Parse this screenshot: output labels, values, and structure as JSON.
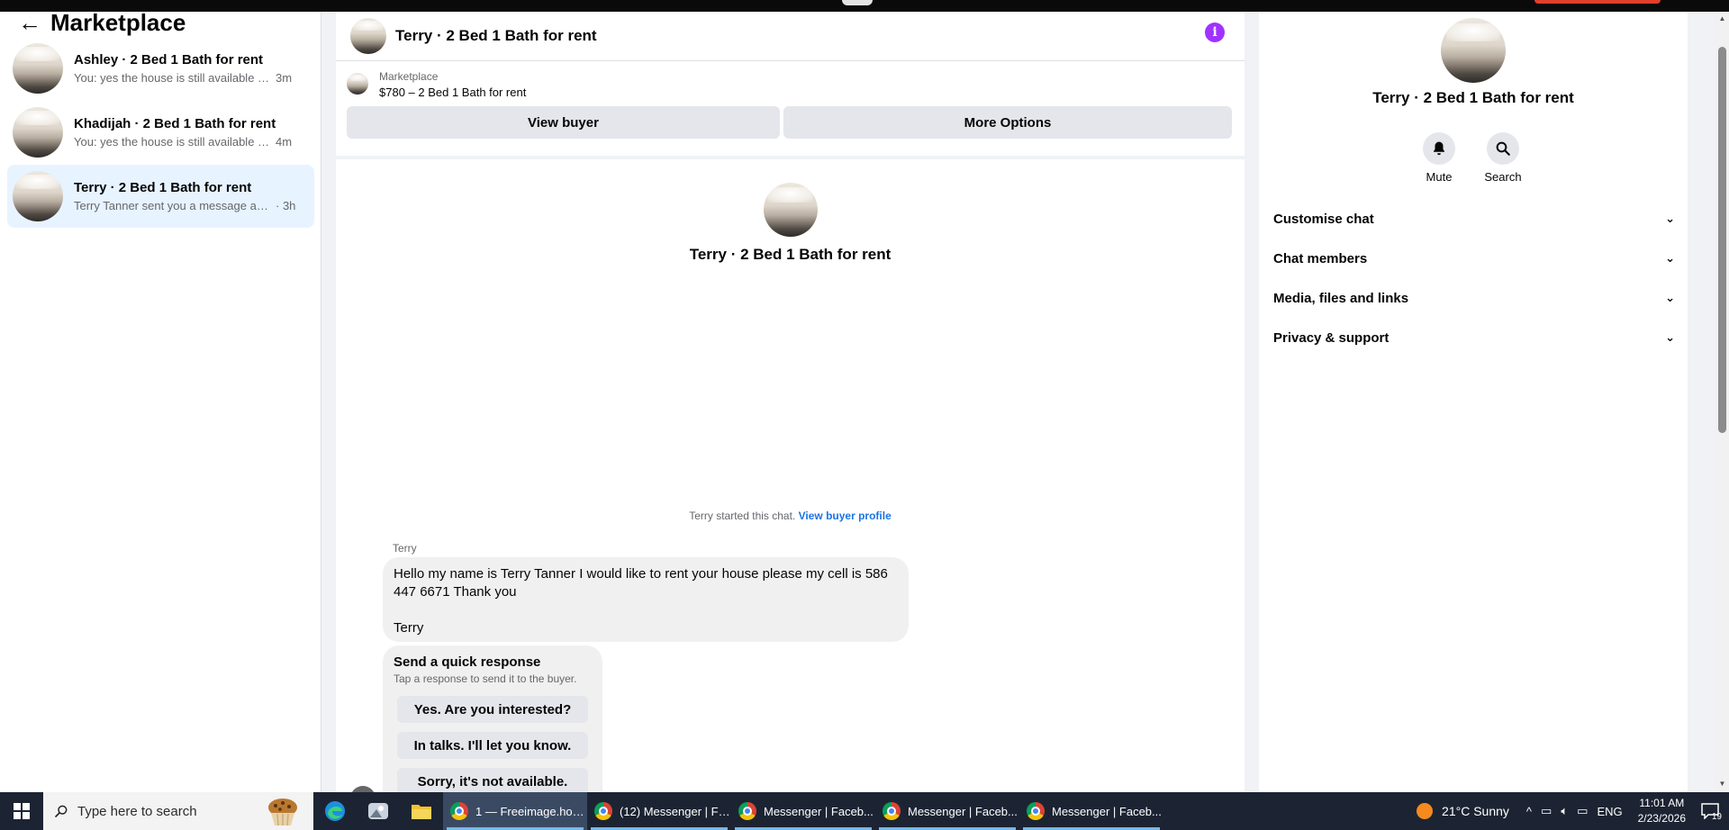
{
  "sidebar": {
    "title": "Marketplace",
    "conversations": [
      {
        "name": "Ashley · 2 Bed 1 Bath for rent",
        "snippet": "You: yes the house is still available for...",
        "time": "3m"
      },
      {
        "name": "Khadijah · 2 Bed 1 Bath for rent",
        "snippet": "You: yes the house is still available for...",
        "time": "4m"
      },
      {
        "name": "Terry · 2 Bed 1 Bath for rent",
        "snippet": "Terry Tanner sent you a message abou...",
        "time": "· 3h"
      }
    ]
  },
  "chat": {
    "title": "Terry · 2 Bed 1 Bath for rent",
    "marketplace_label": "Marketplace",
    "listing": "$780 – 2 Bed 1 Bath for rent",
    "view_buyer": "View buyer",
    "more_options": "More Options",
    "intro_name": "Terry · 2 Bed 1 Bath for rent",
    "started_text": "Terry started this chat.",
    "view_buyer_profile": "View buyer profile",
    "sender": "Terry",
    "message_line1": "Hello my name is Terry Tanner I would like to rent your house please my cell is 586",
    "message_line2": "447 6671 Thank you",
    "message_sign": "Terry",
    "quick_response": {
      "title": "Send a quick response",
      "subtitle": "Tap a response to send it to the buyer.",
      "options": [
        "Yes. Are you interested?",
        "In talks. I'll let you know.",
        "Sorry, it's not available."
      ]
    }
  },
  "details": {
    "name": "Terry · 2 Bed 1 Bath for rent",
    "mute": "Mute",
    "search": "Search",
    "sections": [
      "Customise chat",
      "Chat members",
      "Media, files and links",
      "Privacy & support"
    ]
  },
  "taskbar": {
    "search_placeholder": "Type here to search",
    "apps": [
      "1 — Freeimage.hos...",
      "(12) Messenger | Fa...",
      "Messenger | Faceb...",
      "Messenger | Faceb...",
      "Messenger | Faceb..."
    ],
    "weather": "21°C  Sunny",
    "language": "ENG",
    "time": "11:01 AM",
    "date": "2/23/2026",
    "notifications": "19"
  },
  "colors": {
    "accent_link": "#1b74e4",
    "active_conversation": "#e7f3ff",
    "info_icon": "#a033ff",
    "taskbar": "#1c2433"
  }
}
